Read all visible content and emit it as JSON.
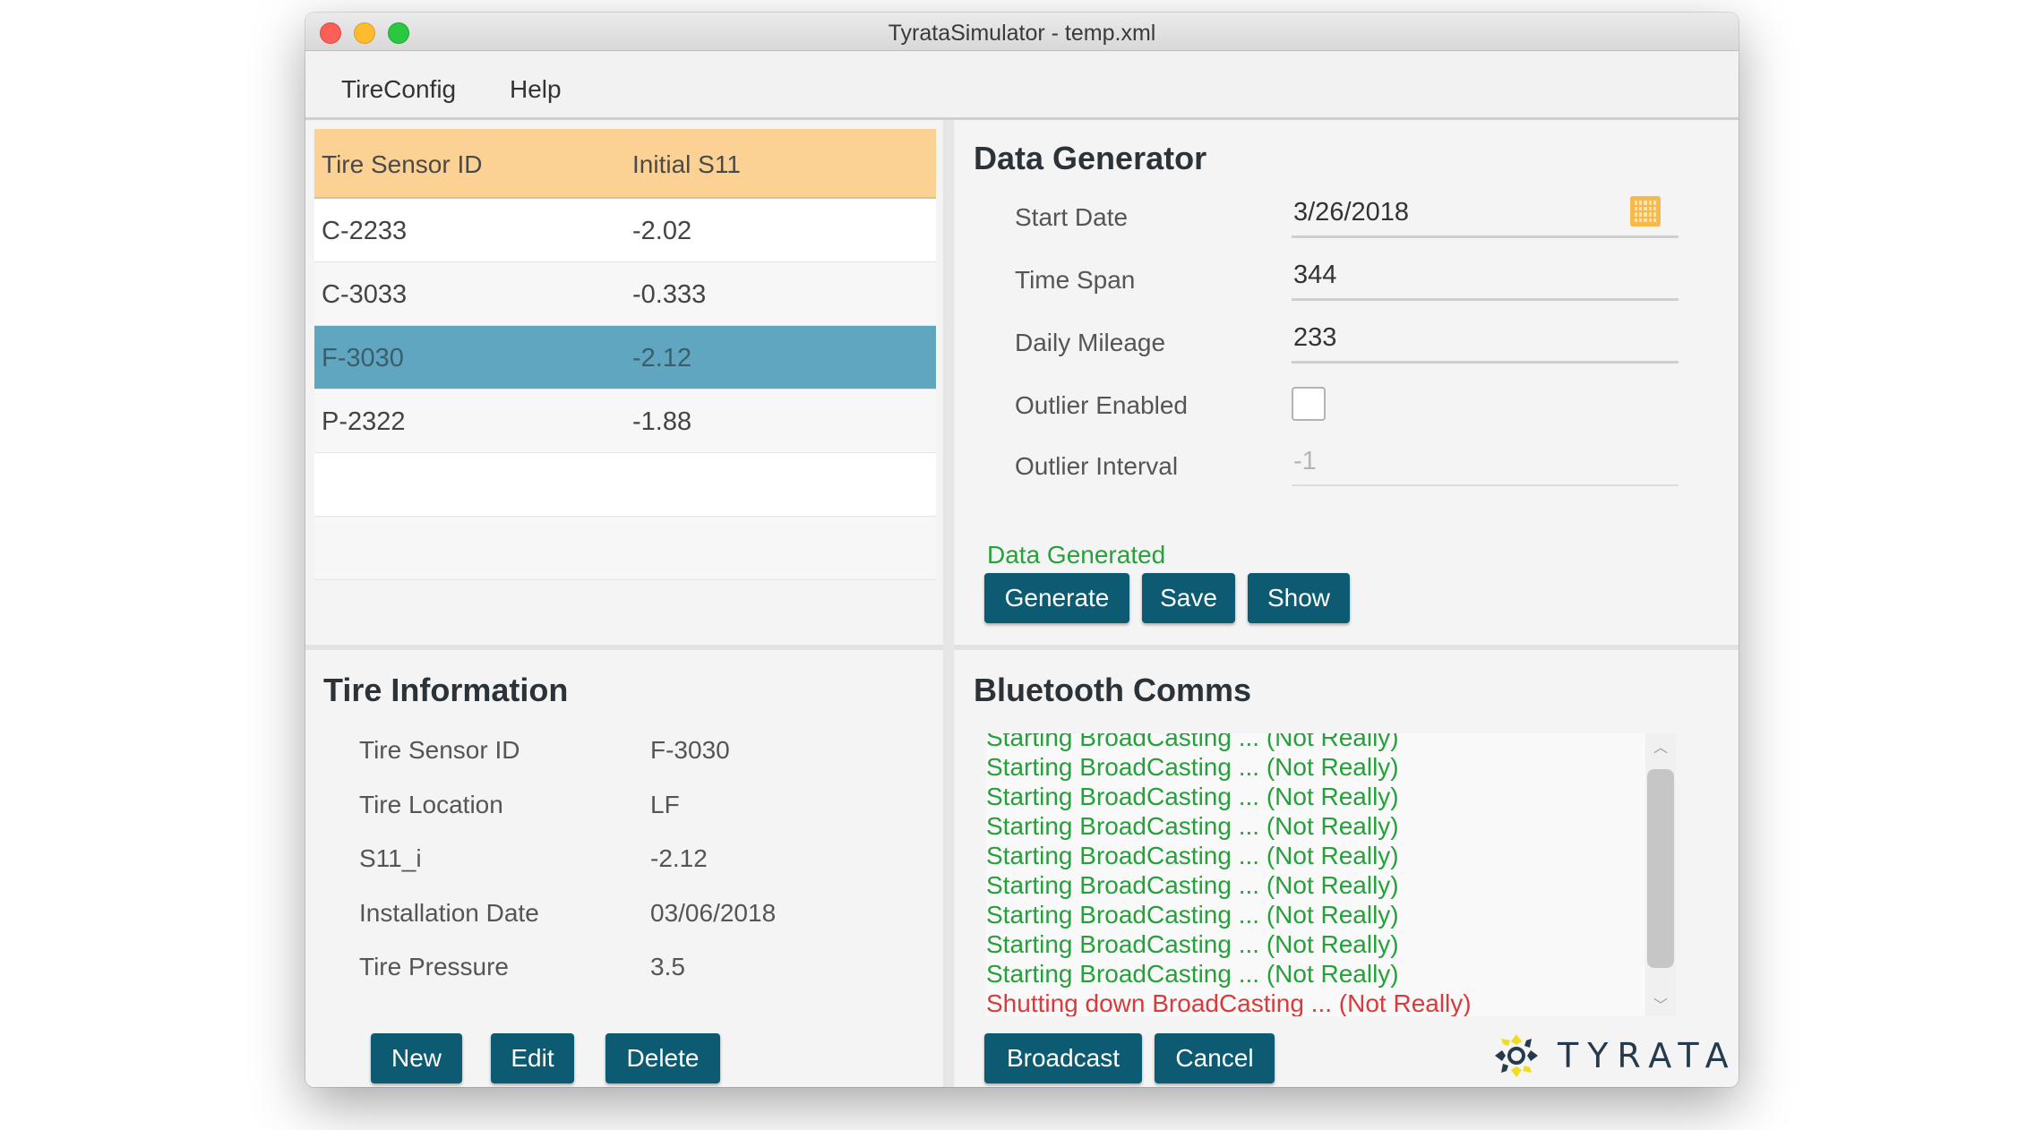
{
  "window": {
    "title": "TyrataSimulator - temp.xml"
  },
  "menu": {
    "items": [
      "TireConfig",
      "Help"
    ]
  },
  "table": {
    "headers": [
      "Tire Sensor ID",
      "Initial S11"
    ],
    "rows": [
      {
        "id": "C-2233",
        "s11": "-2.02"
      },
      {
        "id": "C-3033",
        "s11": "-0.333"
      },
      {
        "id": "F-3030",
        "s11": "-2.12"
      },
      {
        "id": "P-2322",
        "s11": "-1.88"
      }
    ],
    "selected_index": 2
  },
  "generator": {
    "title": "Data Generator",
    "start_date_label": "Start Date",
    "start_date_value": "3/26/2018",
    "time_span_label": "Time Span",
    "time_span_value": "344",
    "daily_mileage_label": "Daily Mileage",
    "daily_mileage_value": "233",
    "outlier_enabled_label": "Outlier Enabled",
    "outlier_enabled_checked": false,
    "outlier_interval_label": "Outlier Interval",
    "outlier_interval_value": "-1",
    "status": "Data Generated",
    "generate_label": "Generate",
    "save_label": "Save",
    "show_label": "Show"
  },
  "info": {
    "title": "Tire Information",
    "fields": [
      {
        "label": "Tire Sensor ID",
        "value": "F-3030"
      },
      {
        "label": "Tire Location",
        "value": "LF"
      },
      {
        "label": "S11_i",
        "value": "-2.12"
      },
      {
        "label": "Installation Date",
        "value": "03/06/2018"
      },
      {
        "label": "Tire Pressure",
        "value": "3.5"
      }
    ],
    "new_label": "New",
    "edit_label": "Edit",
    "delete_label": "Delete"
  },
  "bluetooth": {
    "title": "Bluetooth Comms",
    "log": [
      "Starting BroadCasting ... (Not Really)",
      "Starting BroadCasting ... (Not Really)",
      "Starting BroadCasting ... (Not Really)",
      "Starting BroadCasting ... (Not Really)",
      "Starting BroadCasting ... (Not Really)",
      "Starting BroadCasting ... (Not Really)",
      "Starting BroadCasting ... (Not Really)",
      "Starting BroadCasting ... (Not Really)",
      "Starting BroadCasting ... (Not Really)",
      "Shutting down BroadCasting ... (Not Really)"
    ],
    "broadcast_label": "Broadcast",
    "cancel_label": "Cancel"
  },
  "logo": {
    "text": "TYRATA"
  },
  "colors": {
    "header": "#fcd194",
    "selected_row": "#61a6c0",
    "button": "#0d5b73",
    "status_ok": "#25a03a",
    "status_stop": "#d83b3b"
  }
}
